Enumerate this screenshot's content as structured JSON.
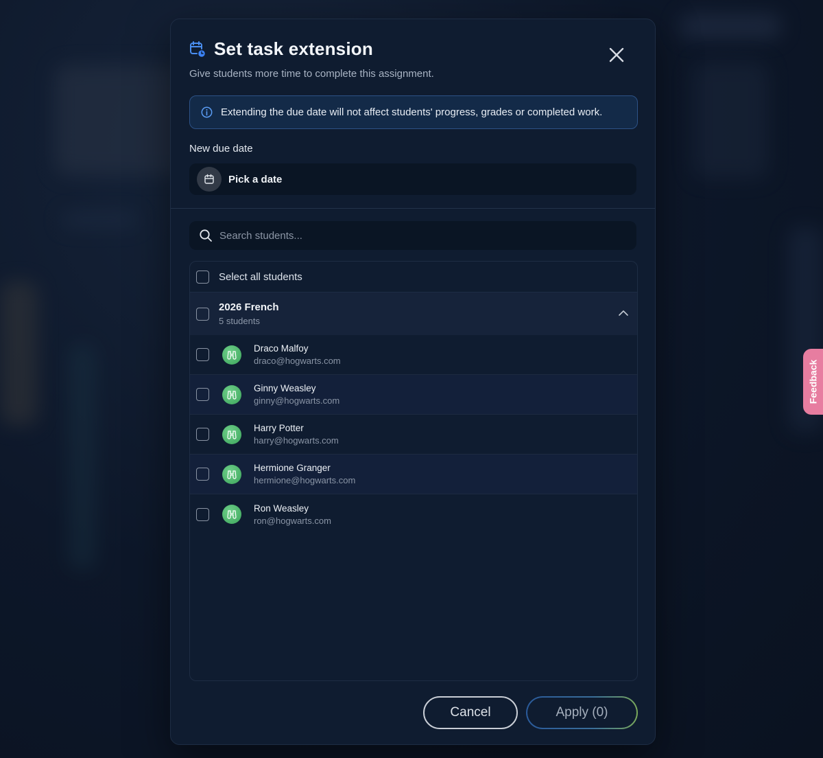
{
  "modal": {
    "title": "Set task extension",
    "subtitle": "Give students more time to complete this assignment.",
    "info": "Extending the due date will not affect students' progress, grades or completed work.",
    "due_date_label": "New due date",
    "date_placeholder": "Pick a date",
    "search_placeholder": "Search students...",
    "select_all_label": "Select all students",
    "group": {
      "name": "2026 French",
      "count": "5 students"
    },
    "students": [
      {
        "name": "Draco Malfoy",
        "email": "draco@hogwarts.com"
      },
      {
        "name": "Ginny Weasley",
        "email": "ginny@hogwarts.com"
      },
      {
        "name": "Harry Potter",
        "email": "harry@hogwarts.com"
      },
      {
        "name": "Hermione Granger",
        "email": "hermione@hogwarts.com"
      },
      {
        "name": "Ron Weasley",
        "email": "ron@hogwarts.com"
      }
    ],
    "cancel_label": "Cancel",
    "apply_label": "Apply (0)"
  },
  "feedback_label": "Feedback",
  "colors": {
    "accent": "#3b82f6",
    "avatar": "#4caf6a",
    "feedback": "#e77da0"
  },
  "icons": [
    "calendar-clock-icon",
    "close-icon",
    "info-icon",
    "calendar-icon",
    "search-icon",
    "chevron-up-icon",
    "binoculars-icon"
  ]
}
